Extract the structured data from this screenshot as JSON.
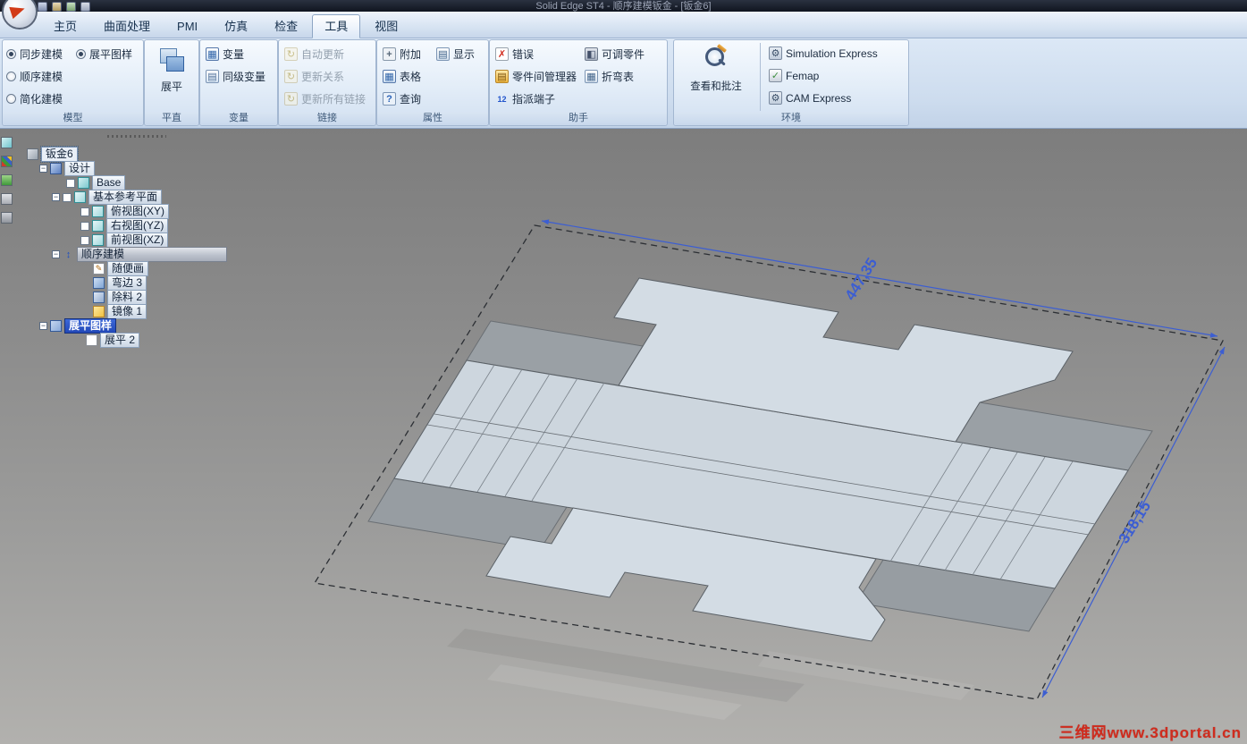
{
  "title_bar": {
    "title": "Solid Edge ST4 - 顺序建模钣金 - [钣金6]"
  },
  "ribbon": {
    "tabs": [
      "主页",
      "曲面处理",
      "PMI",
      "仿真",
      "检查",
      "工具",
      "视图"
    ],
    "active_tab": "工具",
    "groups": {
      "model": {
        "label": "模型",
        "options": [
          {
            "label": "同步建模",
            "selected": true
          },
          {
            "label": "顺序建模",
            "selected": false
          },
          {
            "label": "简化建模",
            "selected": false
          },
          {
            "label": "展平图样",
            "selected": true
          }
        ]
      },
      "flat": {
        "label": "平直",
        "button": "展平"
      },
      "variables": {
        "label": "变量",
        "items": [
          "变量",
          "同级变量"
        ]
      },
      "links": {
        "label": "链接",
        "items": [
          "自动更新",
          "更新关系",
          "更新所有链接"
        ],
        "disabled": true
      },
      "properties": {
        "label": "属性",
        "items": [
          "附加",
          "显示",
          "表格",
          "查询"
        ]
      },
      "assistants": {
        "label": "助手",
        "items": [
          "错误",
          "可调零件",
          "零件间管理器",
          "折弯表",
          "指派端子"
        ]
      },
      "environment": {
        "label": "环境",
        "view_markup": "查看和批注",
        "items": [
          "Simulation Express",
          "Femap",
          "CAM Express"
        ]
      }
    }
  },
  "pathfinder": {
    "items": [
      {
        "label": "钣金6"
      },
      {
        "label": "设计"
      },
      {
        "label": "Base"
      },
      {
        "label": "基本参考平面"
      },
      {
        "label": "俯视图(XY)"
      },
      {
        "label": "右视图(YZ)"
      },
      {
        "label": "前视图(XZ)"
      },
      {
        "label": "顺序建模"
      },
      {
        "label": "随便画"
      },
      {
        "label": "弯边 3"
      },
      {
        "label": "除料 2"
      },
      {
        "label": "镜像 1"
      },
      {
        "label": "展平图样"
      },
      {
        "label": "展平 2"
      }
    ]
  },
  "viewport": {
    "dimensions": {
      "width": "447,35",
      "height": "318,15"
    },
    "watermark": "三维网www.3dportal.cn",
    "colors": {
      "dimension_blue": "#3c5ed2",
      "part_light": "#d2dbe3",
      "part_gray": "#9aa0a5",
      "selection_blue": "#2b57c8"
    }
  },
  "icons": {
    "update": "↻",
    "table": "▦",
    "display": "▤",
    "query": "?",
    "error": "✗",
    "ordered-modeling": "↕",
    "sketch": "✎",
    "terminal": "12",
    "gear": "⚙",
    "femap-check": "✓"
  }
}
